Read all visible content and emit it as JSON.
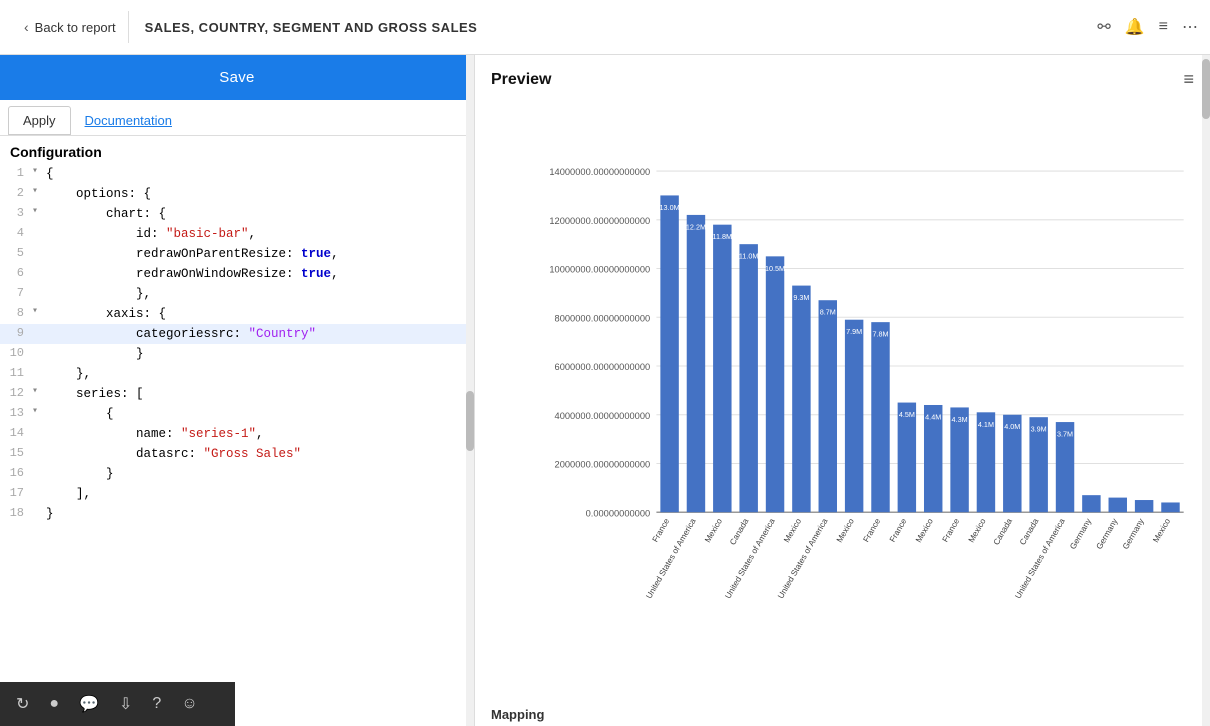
{
  "header": {
    "back_label": "Back to report",
    "report_title": "SALES, COUNTRY, SEGMENT AND GROSS SALES",
    "icons": [
      "pin-icon",
      "bell-icon",
      "menu-icon",
      "more-icon"
    ]
  },
  "left_panel": {
    "save_button": "Save",
    "tabs": [
      {
        "label": "Apply",
        "active": true
      },
      {
        "label": "Documentation",
        "active": false
      }
    ],
    "config_label": "Configuration",
    "code_lines": [
      {
        "num": "1",
        "indent": 0,
        "content": "{",
        "arrow": "▾"
      },
      {
        "num": "2",
        "indent": 1,
        "content": "options: {",
        "arrow": "▾"
      },
      {
        "num": "3",
        "indent": 2,
        "content": "chart: {",
        "arrow": "▾"
      },
      {
        "num": "4",
        "indent": 3,
        "content": "id: \"basic-bar\","
      },
      {
        "num": "5",
        "indent": 3,
        "content": "redrawOnParentResize: true,"
      },
      {
        "num": "6",
        "indent": 3,
        "content": "redrawOnWindowResize: true,"
      },
      {
        "num": "7",
        "indent": 3,
        "content": "},"
      },
      {
        "num": "8",
        "indent": 2,
        "content": "xaxis: {",
        "arrow": "▾"
      },
      {
        "num": "9",
        "indent": 3,
        "content": "categoriessrc: \"Country\"",
        "highlight": true
      },
      {
        "num": "10",
        "indent": 3,
        "content": "}"
      },
      {
        "num": "11",
        "indent": 1,
        "content": "},"
      },
      {
        "num": "12",
        "indent": 1,
        "content": "series: [",
        "arrow": "▾"
      },
      {
        "num": "13",
        "indent": 2,
        "content": "{",
        "arrow": "▾"
      },
      {
        "num": "14",
        "indent": 3,
        "content": "name: \"series-1\","
      },
      {
        "num": "15",
        "indent": 3,
        "content": "datasrc: \"Gross Sales\""
      },
      {
        "num": "16",
        "indent": 2,
        "content": "}"
      },
      {
        "num": "17",
        "indent": 1,
        "content": "],"
      },
      {
        "num": "18",
        "indent": 0,
        "content": "}"
      }
    ]
  },
  "toolbar": {
    "icons": [
      "refresh-icon",
      "record-icon",
      "chat-icon",
      "download-icon",
      "help-icon",
      "emoji-icon"
    ]
  },
  "right_panel": {
    "preview_title": "Preview",
    "hamburger": "≡",
    "chart": {
      "y_labels": [
        "14000000.00000000000",
        "12000000.00000000000",
        "10000000.00000000000",
        "8000000.00000000000",
        "6000000.00000000000",
        "4000000.00000000000",
        "2000000.00000000000",
        "0.00000000000"
      ],
      "bars": [
        {
          "label": "France",
          "value": 13000000,
          "color": "#4472c4"
        },
        {
          "label": "United States of America",
          "value": 12200000,
          "color": "#4472c4"
        },
        {
          "label": "Mexico",
          "value": 11800000,
          "color": "#4472c4"
        },
        {
          "label": "Canada",
          "value": 11000000,
          "color": "#4472c4"
        },
        {
          "label": "United States of America",
          "value": 10500000,
          "color": "#4472c4"
        },
        {
          "label": "Mexico",
          "value": 9300000,
          "color": "#4472c4"
        },
        {
          "label": "United States of America",
          "value": 8700000,
          "color": "#4472c4"
        },
        {
          "label": "Mexico",
          "value": 7900000,
          "color": "#4472c4"
        },
        {
          "label": "France",
          "value": 7800000,
          "color": "#4472c4"
        },
        {
          "label": "France",
          "value": 4500000,
          "color": "#4472c4"
        },
        {
          "label": "Mexico",
          "value": 4400000,
          "color": "#4472c4"
        },
        {
          "label": "France",
          "value": 4300000,
          "color": "#4472c4"
        },
        {
          "label": "Mexico",
          "value": 4100000,
          "color": "#4472c4"
        },
        {
          "label": "Canada",
          "value": 4000000,
          "color": "#4472c4"
        },
        {
          "label": "Canada",
          "value": 3900000,
          "color": "#4472c4"
        },
        {
          "label": "United States of America",
          "value": 3700000,
          "color": "#4472c4"
        },
        {
          "label": "Germany",
          "value": 700000,
          "color": "#4472c4"
        },
        {
          "label": "Germany",
          "value": 600000,
          "color": "#4472c4"
        },
        {
          "label": "Germany",
          "value": 500000,
          "color": "#4472c4"
        },
        {
          "label": "Mexico",
          "value": 400000,
          "color": "#4472c4"
        }
      ],
      "max_value": 14000000
    },
    "bottom_label": "Mapping"
  }
}
